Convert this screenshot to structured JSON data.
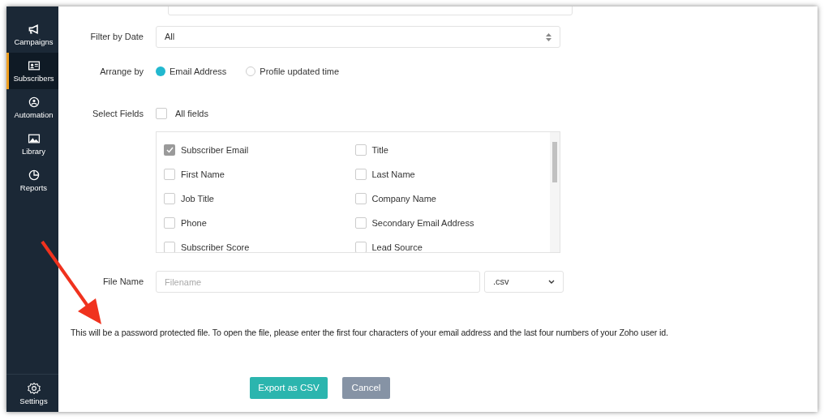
{
  "sidebar": {
    "items": [
      {
        "label": "Campaigns",
        "selected": false
      },
      {
        "label": "Subscribers",
        "selected": true
      },
      {
        "label": "Automation",
        "selected": false
      },
      {
        "label": "Library",
        "selected": false
      },
      {
        "label": "Reports",
        "selected": false
      }
    ],
    "footer": {
      "label": "Settings"
    }
  },
  "form": {
    "filter_by_date": {
      "label": "Filter by Date",
      "value": "All"
    },
    "arrange_by": {
      "label": "Arrange by",
      "options": [
        {
          "label": "Email Address",
          "selected": true
        },
        {
          "label": "Profile updated time",
          "selected": false
        }
      ]
    },
    "select_fields": {
      "label": "Select Fields",
      "all_fields": {
        "label": "All fields",
        "checked": false
      },
      "fields": [
        {
          "label": "Subscriber Email",
          "checked": true,
          "disabled": true
        },
        {
          "label": "Title",
          "checked": false,
          "disabled": false
        },
        {
          "label": "First Name",
          "checked": false,
          "disabled": false
        },
        {
          "label": "Last Name",
          "checked": false,
          "disabled": false
        },
        {
          "label": "Job Title",
          "checked": false,
          "disabled": false
        },
        {
          "label": "Company Name",
          "checked": false,
          "disabled": false
        },
        {
          "label": "Phone",
          "checked": false,
          "disabled": false
        },
        {
          "label": "Secondary Email Address",
          "checked": false,
          "disabled": false
        },
        {
          "label": "Subscriber Score",
          "checked": false,
          "disabled": false
        },
        {
          "label": "Lead Source",
          "checked": false,
          "disabled": false
        }
      ]
    },
    "file_name": {
      "label": "File Name",
      "placeholder": "Filename",
      "extension": ".csv"
    },
    "note": "This will be a password protected file. To open the file, please enter the first four characters of your email address and the last four numbers of your Zoho user id.",
    "buttons": [
      {
        "label": "Export as CSV",
        "kind": "primary"
      },
      {
        "label": "Cancel",
        "kind": "secondary"
      }
    ]
  }
}
